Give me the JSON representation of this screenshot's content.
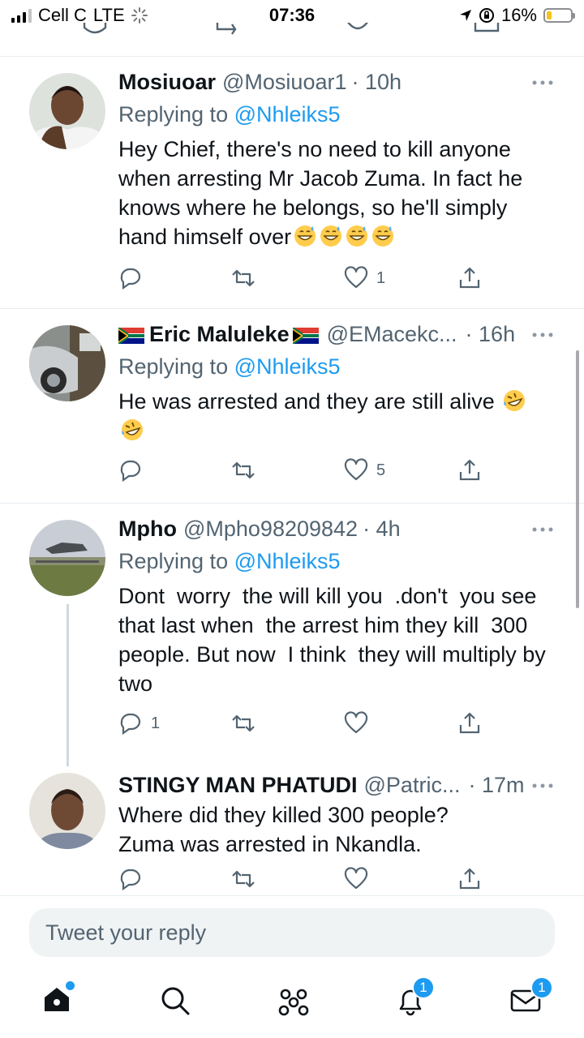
{
  "status": {
    "carrier": "Cell C",
    "network": "LTE",
    "time": "07:36",
    "battery": "16%",
    "battery_level": 0.16
  },
  "tweets": [
    {
      "name": "Mosiuoar",
      "handle": "@Mosiuoar1",
      "time": "· 10h",
      "reply_prefix": "Replying to",
      "reply_to": "@Nhleiks5",
      "text": "Hey Chief, there's no need to kill anyone when arresting Mr Jacob Zuma. In fact he knows where he belongs, so he'll simply hand himself over",
      "emoji": "grinning-sweat-emoji",
      "reply_count": "",
      "like_count": "1"
    },
    {
      "name": "Eric Maluleke",
      "handle": "@EMacekc...",
      "time": "· 16h",
      "reply_prefix": "Replying to",
      "reply_to": "@Nhleiks5",
      "text": "He was arrested and they are still alive",
      "emoji": "rolling-laughing-emoji",
      "reply_count": "",
      "like_count": "5"
    },
    {
      "name": "Mpho",
      "handle": "@Mpho98209842",
      "time": "· 4h",
      "reply_prefix": "Replying to",
      "reply_to": "@Nhleiks5",
      "text": "Dont  worry  the will kill you  .don't  you see that last when  the arrest him they kill  300 people. But now  I think  they will multiply by two",
      "reply_count": "1",
      "like_count": ""
    },
    {
      "name": "STINGY MAN PHATUDI",
      "handle": "@Patric...",
      "time": "· 17m",
      "text": "Where did they killed 300 people?\nZuma was arrested in Nkandla.",
      "reply_count": "",
      "like_count": ""
    }
  ],
  "compose": {
    "placeholder": "Tweet your reply"
  },
  "tabbar": {
    "notifications_badge": "1",
    "messages_badge": "1"
  },
  "colors": {
    "accent": "#1d9bf0",
    "secondary_text": "#536471",
    "divider": "#e6ecf0"
  }
}
